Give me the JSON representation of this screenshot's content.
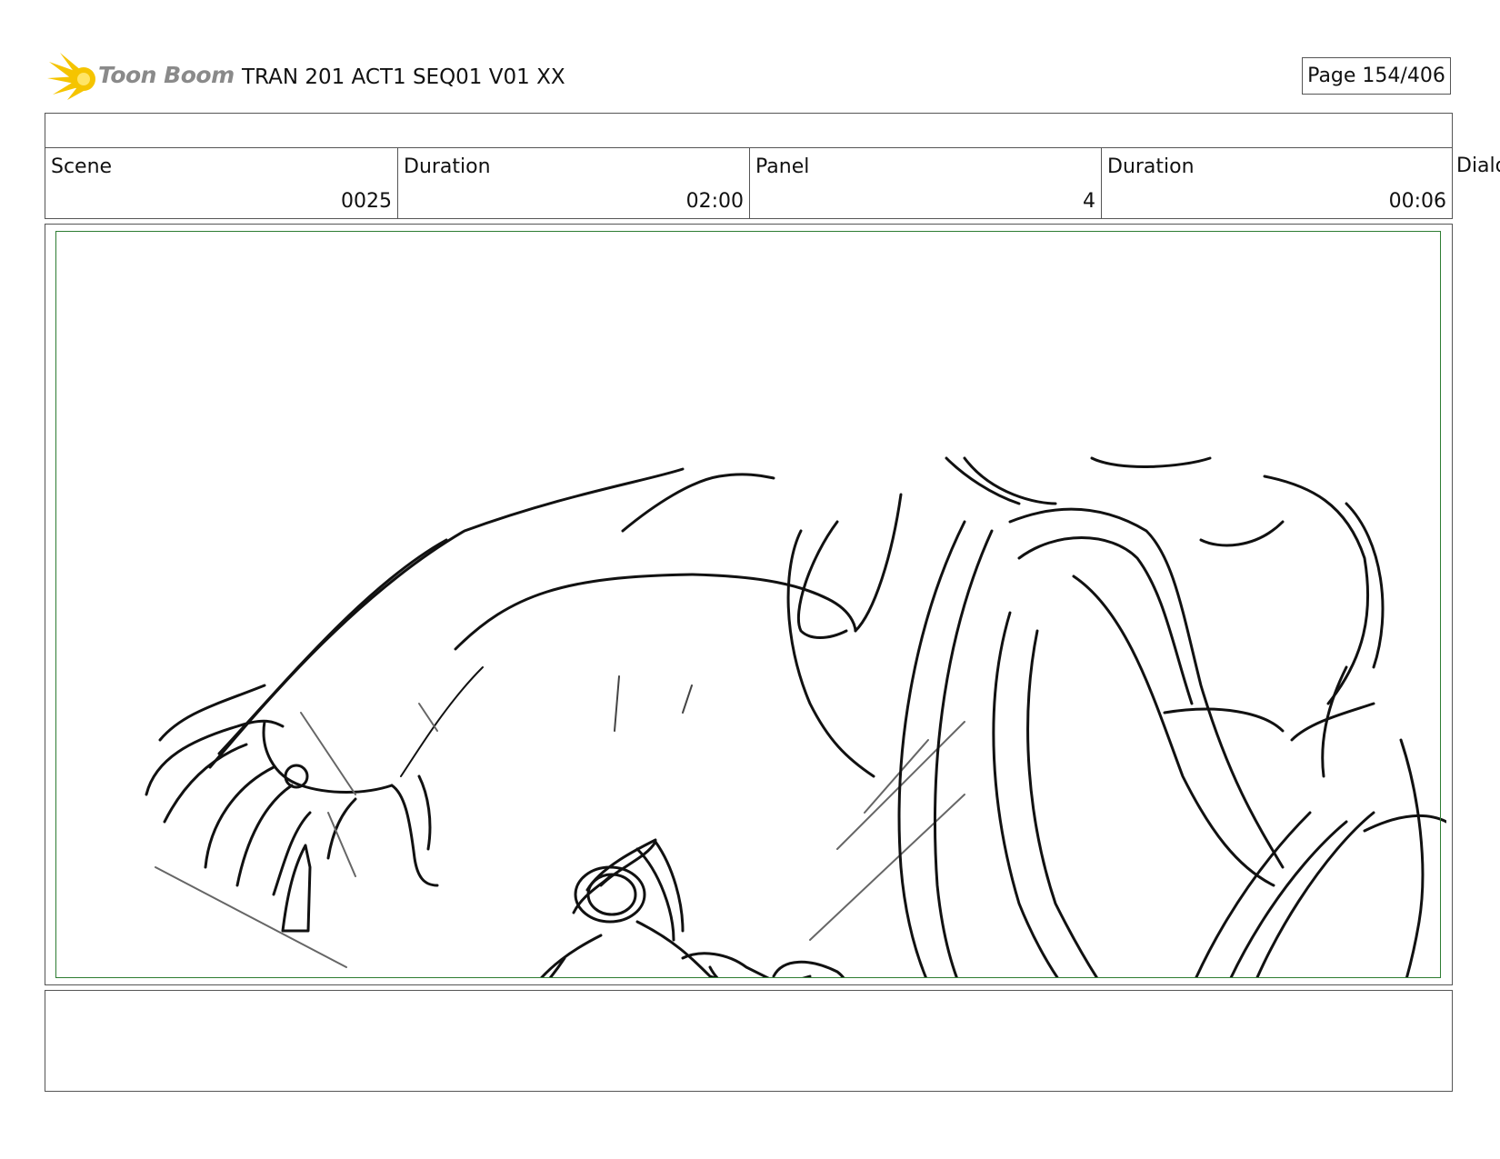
{
  "brand": {
    "name": "Toon Boom",
    "accent": "#f5c400"
  },
  "document": {
    "title": "TRAN 201 ACT1 SEQ01 V01 XX",
    "page": "Page 154/406"
  },
  "info": {
    "scene_label": "Scene",
    "scene_value": "0025",
    "scene_duration_label": "Duration",
    "scene_duration_value": "02:00",
    "panel_label": "Panel",
    "panel_value": "4",
    "panel_duration_label": "Duration",
    "panel_duration_value": "00:06",
    "dialog_label": "Dialo"
  },
  "panel": {
    "frame_color": "#2e7d32",
    "image": "storyboard sketch: small creature crouching on the ground beneath a giant figure's reaching hand"
  },
  "notes": ""
}
